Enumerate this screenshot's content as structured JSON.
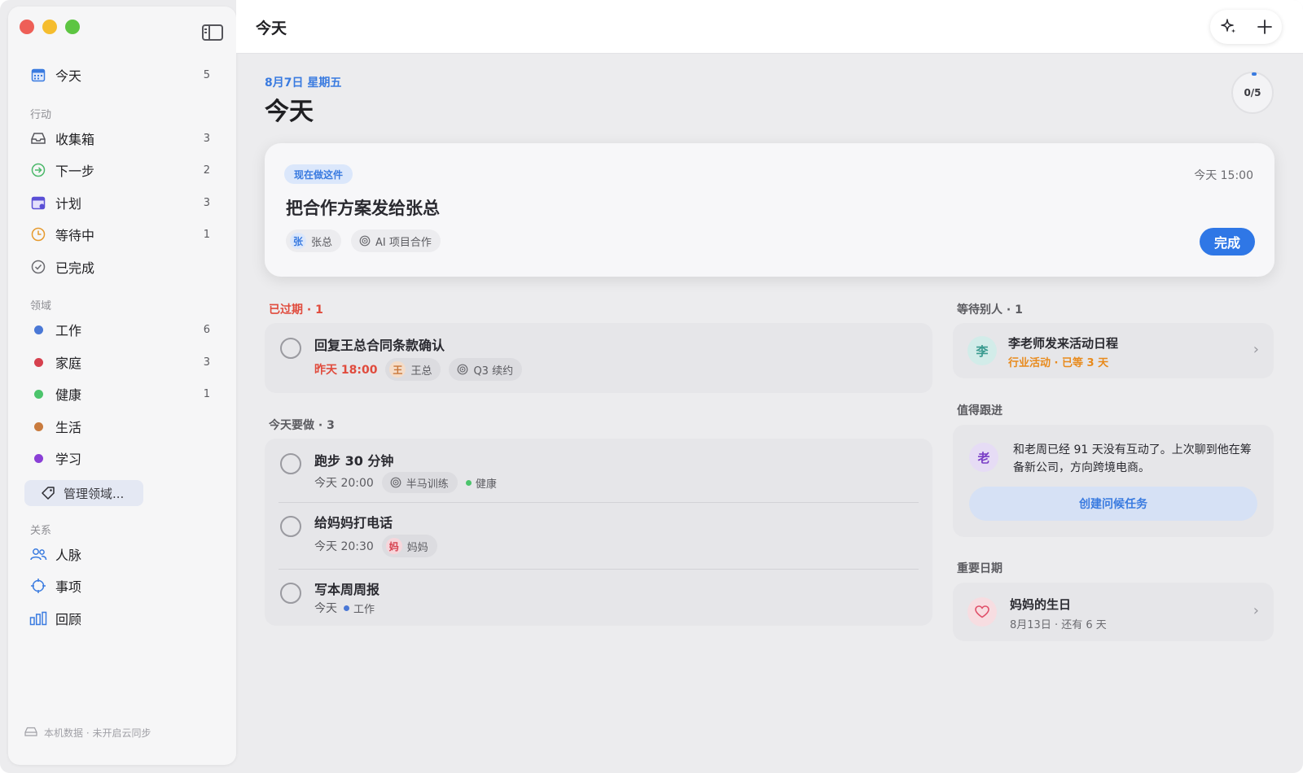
{
  "sidebar": {
    "today": {
      "label": "今天",
      "count": "5"
    },
    "sections": {
      "actions": "行动",
      "areas": "领域",
      "relations": "关系"
    },
    "action_items": [
      {
        "label": "收集箱",
        "count": "3",
        "icon": "inbox-icon"
      },
      {
        "label": "下一步",
        "count": "2",
        "icon": "next-arrow-icon"
      },
      {
        "label": "计划",
        "count": "3",
        "icon": "calendar-plan-icon"
      },
      {
        "label": "等待中",
        "count": "1",
        "icon": "clock-icon"
      },
      {
        "label": "已完成",
        "count": "",
        "icon": "check-circle-icon"
      }
    ],
    "area_items": [
      {
        "label": "工作",
        "count": "6",
        "color": "#4a78d6"
      },
      {
        "label": "家庭",
        "count": "3",
        "color": "#d6404e"
      },
      {
        "label": "健康",
        "count": "1",
        "color": "#4cc46c"
      },
      {
        "label": "生活",
        "count": "",
        "color": "#c97b3e"
      },
      {
        "label": "学习",
        "count": "",
        "color": "#8a3fd6"
      }
    ],
    "manage_areas": "管理领域...",
    "relation_items": [
      {
        "label": "人脉",
        "icon": "people-icon"
      },
      {
        "label": "事项",
        "icon": "target-icon"
      },
      {
        "label": "回顾",
        "icon": "bar-chart-icon"
      }
    ],
    "footer": "本机数据 · 未开启云同步"
  },
  "topbar": {
    "title": "今天"
  },
  "header": {
    "date": "8月7日 星期五",
    "title": "今天",
    "progress": "0/5"
  },
  "focus": {
    "badge": "现在做这件",
    "time": "今天 15:00",
    "title": "把合作方案发给张总",
    "person_avatar": "张",
    "person": "张总",
    "project": "AI 项目合作",
    "done": "完成"
  },
  "overdue": {
    "label": "已过期 · 1",
    "tasks": [
      {
        "title": "回复王总合同条款确认",
        "time": "昨天 18:00",
        "avatar": "王",
        "person": "王总",
        "project": "Q3 续约"
      }
    ]
  },
  "today_tasks": {
    "label": "今天要做 · 3",
    "tasks": [
      {
        "title": "跑步 30 分钟",
        "time": "今天 20:00",
        "project": "半马训练",
        "area": "健康"
      },
      {
        "title": "给妈妈打电话",
        "time": "今天 20:30",
        "avatar": "妈",
        "person": "妈妈"
      },
      {
        "title": "写本周周报",
        "time": "今天",
        "area": "工作"
      }
    ]
  },
  "waiting": {
    "label": "等待别人 · 1",
    "avatar": "李",
    "title": "李老师发来活动日程",
    "sub": "行业活动 · 已等 3 天"
  },
  "followup": {
    "label": "值得跟进",
    "avatar": "老",
    "text": "和老周已经 91 天没有互动了。上次聊到他在筹备新公司，方向跨境电商。",
    "button": "创建问候任务"
  },
  "dates": {
    "label": "重要日期",
    "title": "妈妈的生日",
    "sub": "8月13日 · 还有 6 天"
  },
  "colors": {
    "accent": "#2f77e6",
    "overdue": "#e04b3d",
    "waiting_orange": "#e88a1c"
  }
}
